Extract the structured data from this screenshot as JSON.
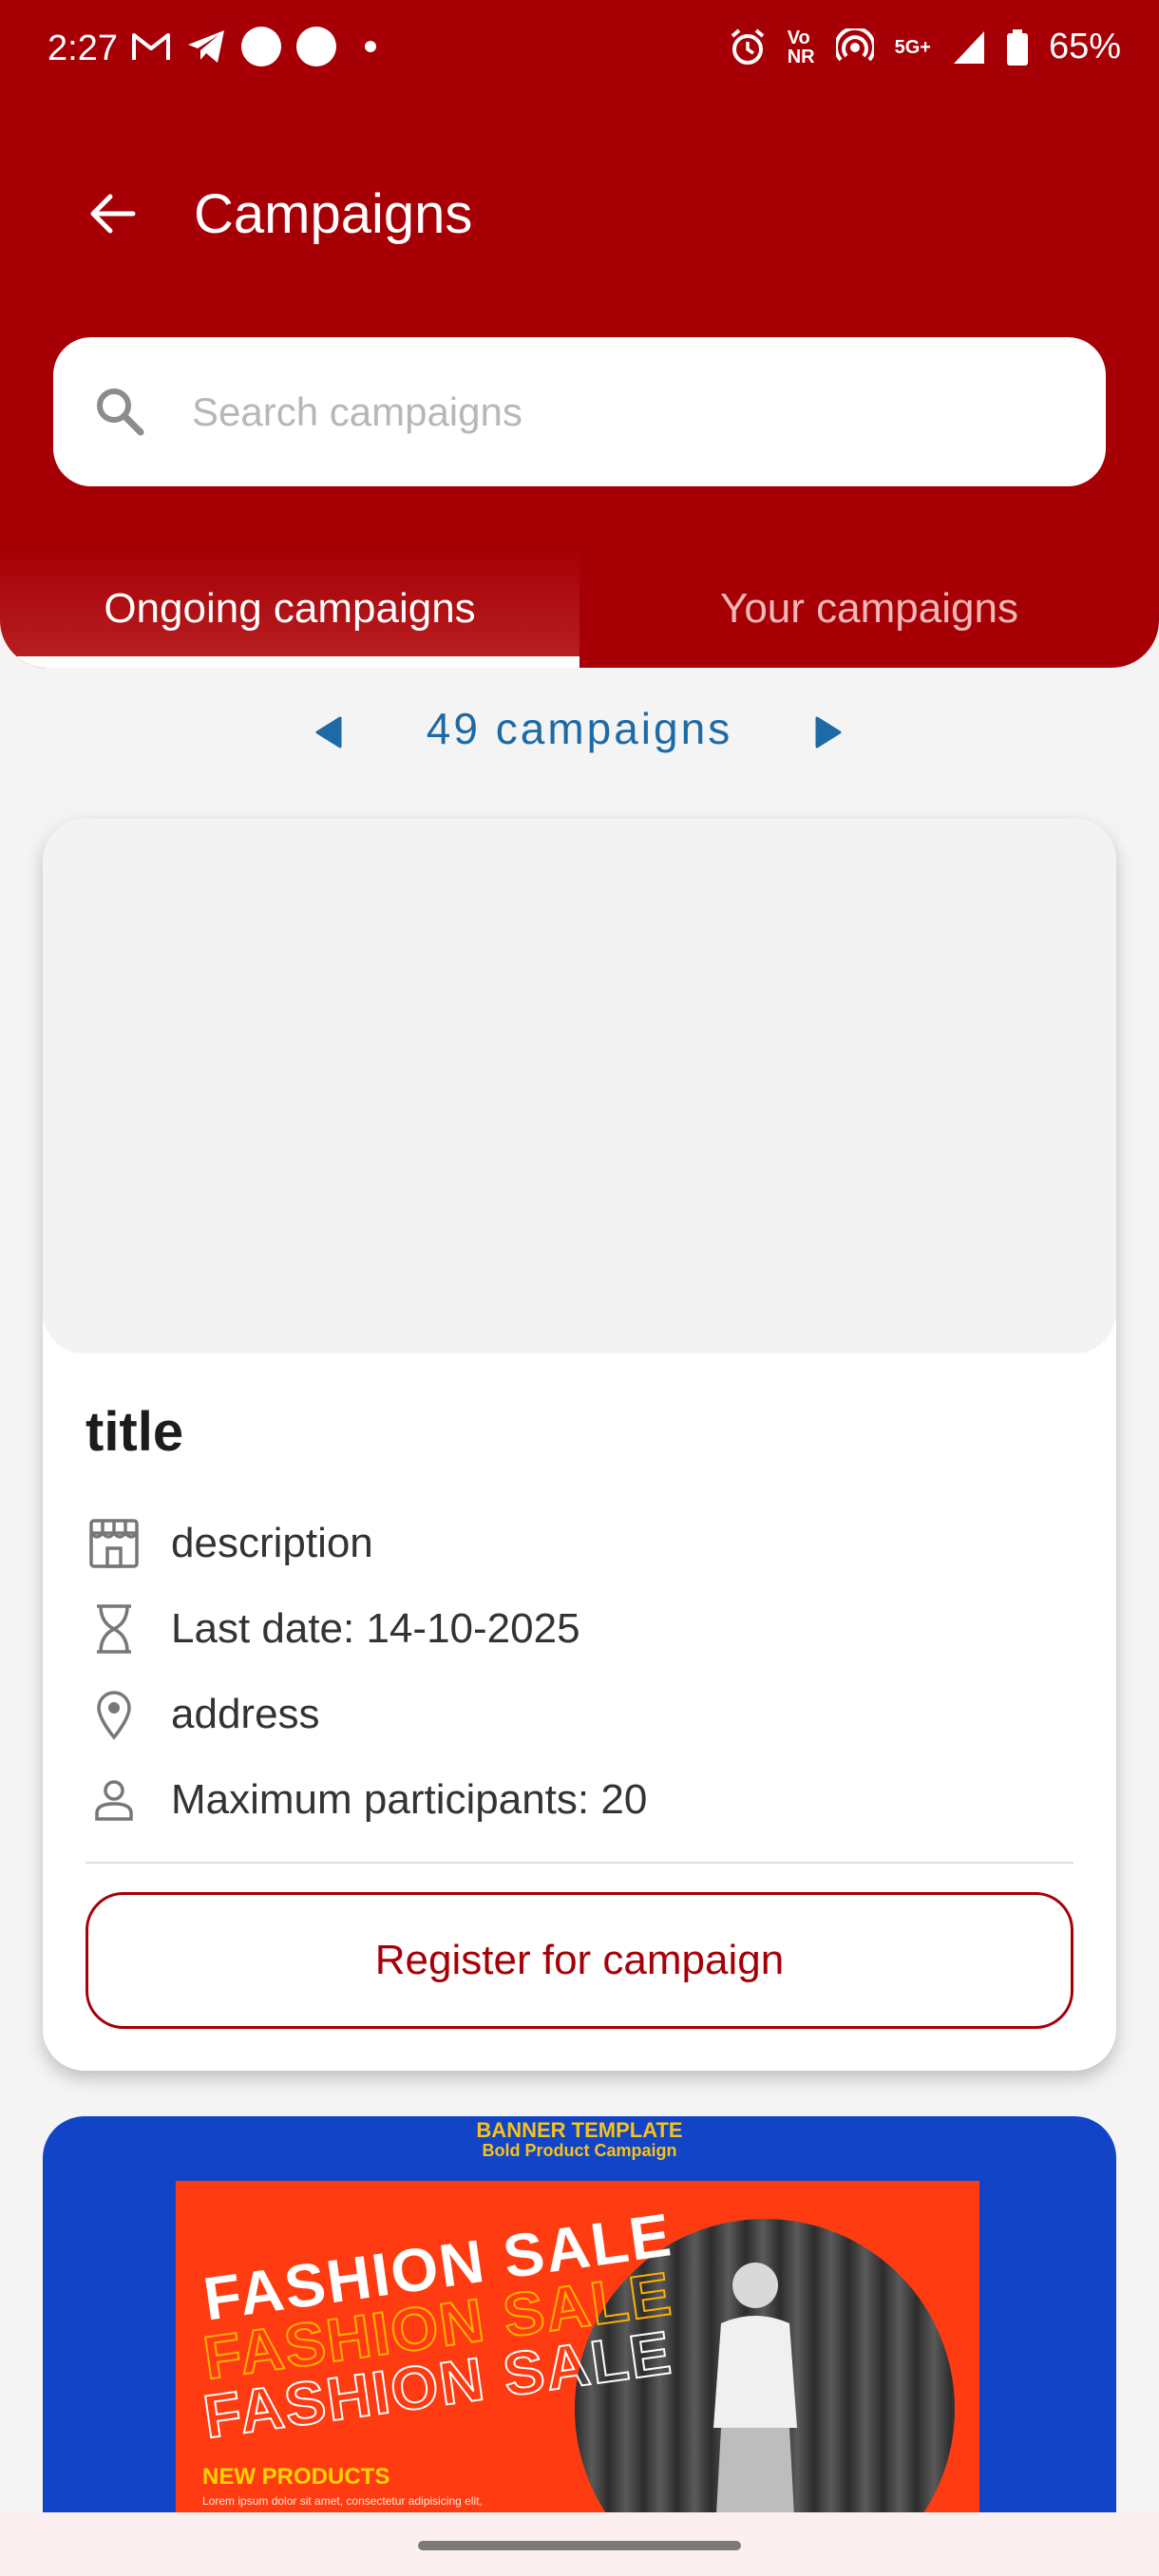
{
  "status_bar": {
    "time": "2:27",
    "network": "5G+",
    "battery": "65%"
  },
  "appbar": {
    "title": "Campaigns"
  },
  "search": {
    "placeholder": "Search campaigns"
  },
  "tabs": [
    {
      "label": "Ongoing campaigns",
      "selected": true
    },
    {
      "label": "Your campaigns",
      "selected": false
    }
  ],
  "pagination": {
    "count_text": "49 campaigns"
  },
  "campaign_card": {
    "title": "title",
    "description": "description",
    "last_date": "Last date: 14-10-2025",
    "address": "address",
    "max_participants": "Maximum participants: 20",
    "register_label": "Register for campaign"
  },
  "banner_card": {
    "head_line_1": "BANNER TEMPLATE",
    "head_line_2": "Bold Product Campaign",
    "poster_line": "FASHION SALE",
    "poster_subhead": "NEW PRODUCTS",
    "poster_body": "Lorem ipsum dolor sit amet, consectetur adipisicing elit,"
  },
  "colors": {
    "primary": "#a60006",
    "accent_text": "#1d6aa6",
    "background": "#f4f4f4",
    "banner_blue": "#1244c8",
    "poster_orange": "#ff3b12"
  }
}
